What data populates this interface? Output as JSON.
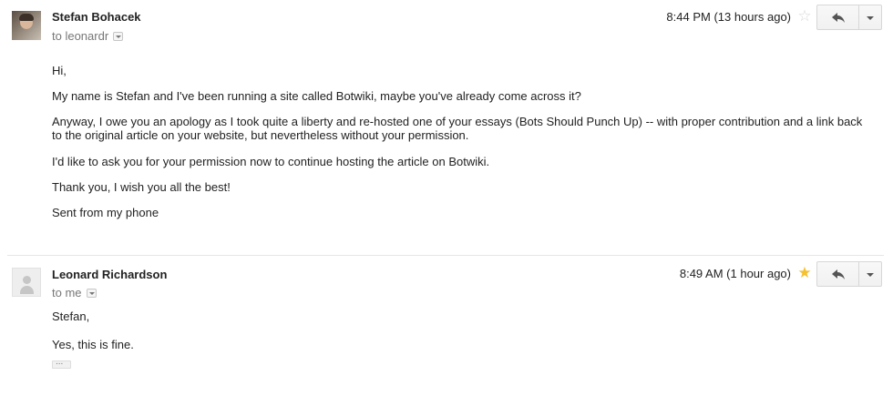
{
  "messages": [
    {
      "sender": "Stefan Bohacek",
      "recipient_line": "to leonardr",
      "time": "8:44 PM (13 hours ago)",
      "starred": false,
      "body": [
        "Hi,",
        "My name is Stefan and I've been running a site called Botwiki, maybe you've already come across it?",
        "Anyway, I owe you an apology as I took quite a liberty and re-hosted one of your essays (Bots Should Punch Up) -- with proper contribution and a link back to the original article on your website, but nevertheless without your permission.",
        "I'd like to ask you for your permission now to continue hosting the article on Botwiki.",
        "Thank you, I wish you all the best!",
        "Sent from my phone"
      ]
    },
    {
      "sender": "Leonard Richardson",
      "recipient_line": "to me",
      "time": "8:49 AM (1 hour ago)",
      "starred": true,
      "body": [
        "Stefan,",
        "Yes, this is fine."
      ],
      "trimmed_content_label": "..."
    }
  ],
  "colors": {
    "star_active": "#f4c131",
    "star_inactive": "#d9d9d9",
    "separator": "#e5e5e5"
  },
  "icons": {
    "reply": "reply-icon",
    "more": "chevron-down-icon",
    "star": "star-icon"
  }
}
